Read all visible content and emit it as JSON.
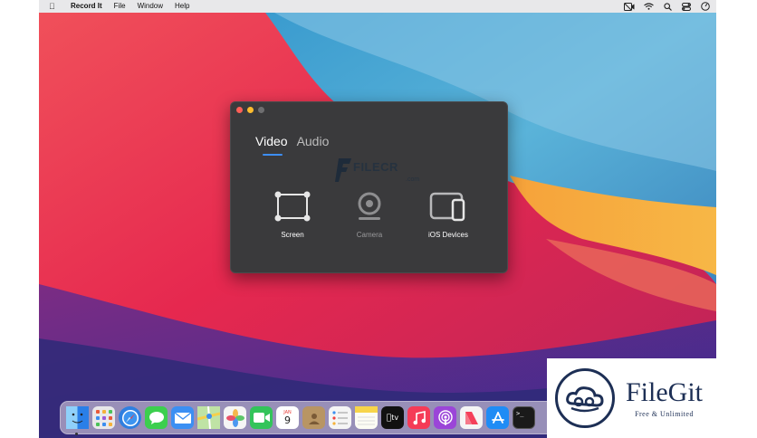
{
  "menubar": {
    "apple_icon": "apple-icon",
    "app_name": "Record It",
    "items": [
      "File",
      "Window",
      "Help"
    ],
    "status_icons": [
      "screen-record-icon",
      "wifi-icon",
      "search-icon",
      "control-center-icon",
      "clock-icon"
    ]
  },
  "window": {
    "tabs": [
      {
        "label": "Video",
        "active": true
      },
      {
        "label": "Audio",
        "active": false
      }
    ],
    "options": [
      {
        "label": "Screen",
        "enabled": true
      },
      {
        "label": "Camera",
        "enabled": false
      },
      {
        "label": "iOS Devices",
        "enabled": true
      }
    ],
    "accent": "#3d8ef5"
  },
  "watermark": {
    "text": "FILECR",
    "suffix": ".com"
  },
  "dock": {
    "apps": [
      {
        "name": "finder-icon",
        "color": "#2a8ff0"
      },
      {
        "name": "launchpad-icon",
        "color": "#e8e8ea"
      },
      {
        "name": "safari-icon",
        "color": "#2f7fe0"
      },
      {
        "name": "messages-icon",
        "color": "#3ccf4e"
      },
      {
        "name": "mail-icon",
        "color": "#3b8ff3"
      },
      {
        "name": "maps-icon",
        "color": "#5fc46a"
      },
      {
        "name": "photos-icon",
        "color": "#f5f5f5"
      },
      {
        "name": "facetime-icon",
        "color": "#33c45a"
      },
      {
        "name": "calendar-icon",
        "color": "#ffffff",
        "month": "JAN",
        "day": "9"
      },
      {
        "name": "contacts-icon",
        "color": "#b89564"
      },
      {
        "name": "reminders-icon",
        "color": "#f5f5f5"
      },
      {
        "name": "notes-icon",
        "color": "#f7d54a"
      },
      {
        "name": "apple-tv-icon",
        "color": "#111111",
        "text": "tv"
      },
      {
        "name": "music-icon",
        "color": "#f53b57"
      },
      {
        "name": "podcasts-icon",
        "color": "#9b45d8"
      },
      {
        "name": "news-icon",
        "color": "#f5f5f5"
      },
      {
        "name": "app-store-icon",
        "color": "#1f8cf5"
      },
      {
        "name": "terminal-icon",
        "color": "#1a1a1a"
      }
    ]
  },
  "filegit": {
    "name": "FileGit",
    "tagline": "Free & Unlimited"
  }
}
